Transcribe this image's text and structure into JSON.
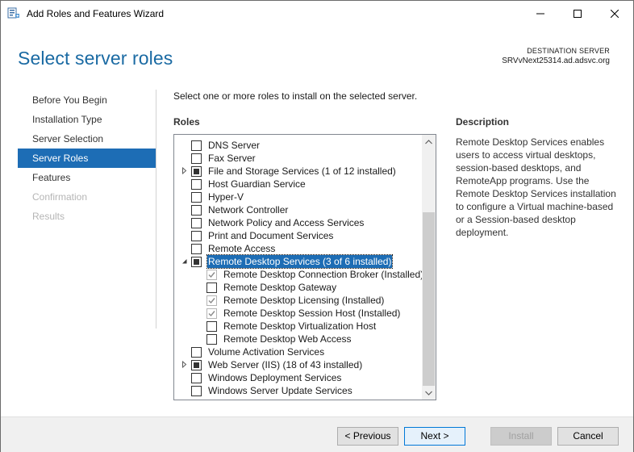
{
  "window": {
    "title": "Add Roles and Features Wizard"
  },
  "header": {
    "page_title": "Select server roles",
    "destination_label": "DESTINATION SERVER",
    "destination_server": "SRVvNext25314.ad.adsvc.org"
  },
  "nav": {
    "items": [
      {
        "label": "Before You Begin",
        "state": "normal"
      },
      {
        "label": "Installation Type",
        "state": "normal"
      },
      {
        "label": "Server Selection",
        "state": "normal"
      },
      {
        "label": "Server Roles",
        "state": "active"
      },
      {
        "label": "Features",
        "state": "normal"
      },
      {
        "label": "Confirmation",
        "state": "disabled"
      },
      {
        "label": "Results",
        "state": "disabled"
      }
    ]
  },
  "main": {
    "instruction": "Select one or more roles to install on the selected server.",
    "roles_heading": "Roles",
    "description_heading": "Description",
    "description_text": "Remote Desktop Services enables users to access virtual desktops, session-based desktops, and RemoteApp programs. Use the Remote Desktop Services installation to configure a Virtual machine-based or a Session-based desktop deployment."
  },
  "roles": [
    {
      "label": "DNS Server",
      "level": 0,
      "check": "unchecked",
      "expander": "none"
    },
    {
      "label": "Fax Server",
      "level": 0,
      "check": "unchecked",
      "expander": "none"
    },
    {
      "label": "File and Storage Services (1 of 12 installed)",
      "level": 0,
      "check": "partial",
      "expander": "collapsed"
    },
    {
      "label": "Host Guardian Service",
      "level": 0,
      "check": "unchecked",
      "expander": "none"
    },
    {
      "label": "Hyper-V",
      "level": 0,
      "check": "unchecked",
      "expander": "none"
    },
    {
      "label": "Network Controller",
      "level": 0,
      "check": "unchecked",
      "expander": "none"
    },
    {
      "label": "Network Policy and Access Services",
      "level": 0,
      "check": "unchecked",
      "expander": "none"
    },
    {
      "label": "Print and Document Services",
      "level": 0,
      "check": "unchecked",
      "expander": "none"
    },
    {
      "label": "Remote Access",
      "level": 0,
      "check": "unchecked",
      "expander": "none"
    },
    {
      "label": "Remote Desktop Services (3 of 6 installed)",
      "level": 0,
      "check": "partial",
      "expander": "expanded",
      "selected": true
    },
    {
      "label": "Remote Desktop Connection Broker (Installed)",
      "level": 1,
      "check": "checked-disabled",
      "expander": "none"
    },
    {
      "label": "Remote Desktop Gateway",
      "level": 1,
      "check": "unchecked",
      "expander": "none"
    },
    {
      "label": "Remote Desktop Licensing (Installed)",
      "level": 1,
      "check": "checked-disabled",
      "expander": "none"
    },
    {
      "label": "Remote Desktop Session Host (Installed)",
      "level": 1,
      "check": "checked-disabled",
      "expander": "none"
    },
    {
      "label": "Remote Desktop Virtualization Host",
      "level": 1,
      "check": "unchecked",
      "expander": "none"
    },
    {
      "label": "Remote Desktop Web Access",
      "level": 1,
      "check": "unchecked",
      "expander": "none"
    },
    {
      "label": "Volume Activation Services",
      "level": 0,
      "check": "unchecked",
      "expander": "none"
    },
    {
      "label": "Web Server (IIS) (18 of 43 installed)",
      "level": 0,
      "check": "partial",
      "expander": "collapsed"
    },
    {
      "label": "Windows Deployment Services",
      "level": 0,
      "check": "unchecked",
      "expander": "none"
    },
    {
      "label": "Windows Server Update Services",
      "level": 0,
      "check": "unchecked",
      "expander": "none"
    }
  ],
  "footer": {
    "previous_label": "< Previous",
    "next_label": "Next >",
    "install_label": "Install",
    "cancel_label": "Cancel"
  },
  "colors": {
    "accent": "#1d6db5",
    "title": "#1a6aa3"
  }
}
